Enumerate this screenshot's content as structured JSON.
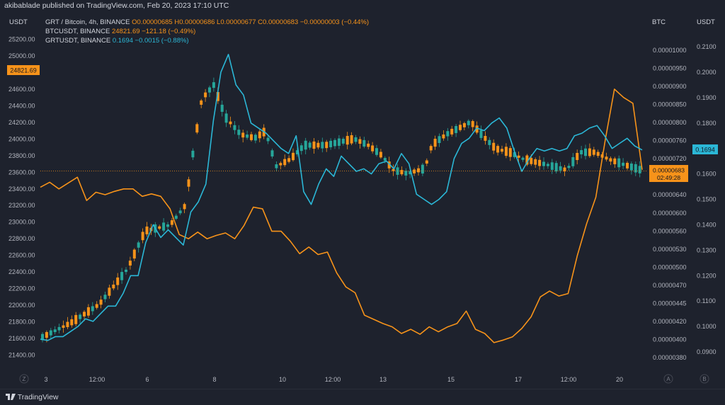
{
  "header": {
    "publisher": "akibablade published on TradingView.com, Feb 20, 2023 17:10 UTC"
  },
  "legend": {
    "grt": {
      "symbol": "GRT / Bitcoin, 4h, BINANCE",
      "ohlc": "O0.00000685 H0.00000686 L0.00000677 C0.00000683 −0.00000003 (−0.44%)"
    },
    "btc": {
      "symbol": "BTCUSDT, BINANCE",
      "value": "24821.69 −121.18 (−0.49%)"
    },
    "grtusdt": {
      "symbol": "GRTUSDT, BINANCE",
      "value": "0.1694 −0.0015 (−0.88%)"
    }
  },
  "axes": {
    "left_title": "USDT",
    "mid_title": "BTC",
    "right_title": "USDT"
  },
  "price_tags": {
    "btc": "24821.69",
    "grt_price": "0.00000683",
    "grt_countdown": "02:49:28",
    "grtusdt": "0.1694"
  },
  "footer": {
    "brand": "TradingView"
  },
  "bottom_marks": {
    "left": "Z",
    "mid": "A",
    "right": "B"
  },
  "colors": {
    "background": "#1e222d",
    "btc_line": "#f7931a",
    "grtusdt_line": "#2bb7d6",
    "candle_up": "#26a69a",
    "candle_down": "#f7931a"
  },
  "chart_data": {
    "type": "line",
    "x_tick_labels": [
      "3",
      "12:00",
      "6",
      "8",
      "10",
      "12:00",
      "13",
      "15",
      "17",
      "12:00",
      "20"
    ],
    "y_left_ticks": [
      "25200.00",
      "25000.00",
      "24600.00",
      "24400.00",
      "24200.00",
      "24000.00",
      "23800.00",
      "23600.00",
      "23400.00",
      "23200.00",
      "23000.00",
      "22800.00",
      "22600.00",
      "22400.00",
      "22200.00",
      "22000.00",
      "21800.00",
      "21600.00",
      "21400.00"
    ],
    "y_mid_ticks": [
      "0.00001000",
      "0.00000950",
      "0.00000900",
      "0.00000850",
      "0.00000800",
      "0.00000760",
      "0.00000720",
      "0.00000683",
      "0.00000640",
      "0.00000600",
      "0.00000560",
      "0.00000530",
      "0.00000500",
      "0.00000470",
      "0.00000445",
      "0.00000420",
      "0.00000400",
      "0.00000380"
    ],
    "y_right_ticks": [
      "0.2100",
      "0.2000",
      "0.1900",
      "0.1800",
      "0.1700",
      "0.1600",
      "0.1500",
      "0.1400",
      "0.1300",
      "0.1200",
      "0.1100",
      "0.1000",
      "0.0900"
    ],
    "series": [
      {
        "name": "BTCUSDT, BINANCE",
        "axis": "left",
        "values": [
          23420,
          23480,
          23400,
          23470,
          23540,
          23260,
          23360,
          23330,
          23370,
          23400,
          23400,
          23310,
          23340,
          23310,
          23160,
          22850,
          22800,
          22880,
          22800,
          22840,
          22870,
          22800,
          22960,
          23180,
          23160,
          22890,
          22890,
          22770,
          22620,
          22700,
          22610,
          22640,
          22390,
          22220,
          22150,
          21880,
          21830,
          21780,
          21740,
          21660,
          21710,
          21650,
          21740,
          21680,
          21740,
          21780,
          21930,
          21710,
          21660,
          21550,
          21580,
          21620,
          21720,
          21860,
          22100,
          22170,
          22110,
          22140,
          22600,
          22980,
          23300,
          23980,
          24600,
          24500,
          24430,
          23630
        ]
      },
      {
        "name": "GRTUSDT, BINANCE",
        "axis": "right",
        "values": [
          0.095,
          0.0945,
          0.096,
          0.096,
          0.098,
          0.1,
          0.103,
          0.102,
          0.105,
          0.108,
          0.108,
          0.113,
          0.12,
          0.12,
          0.133,
          0.14,
          0.135,
          0.138,
          0.135,
          0.132,
          0.145,
          0.149,
          0.156,
          0.181,
          0.2,
          0.207,
          0.195,
          0.191,
          0.18,
          0.178,
          0.176,
          0.173,
          0.17,
          0.168,
          0.175,
          0.153,
          0.148,
          0.156,
          0.162,
          0.159,
          0.167,
          0.164,
          0.161,
          0.162,
          0.16,
          0.164,
          0.165,
          0.162,
          0.168,
          0.164,
          0.152,
          0.15,
          0.148,
          0.15,
          0.153,
          0.166,
          0.172,
          0.174,
          0.178,
          0.177,
          0.18,
          0.182,
          0.178,
          0.169,
          0.161,
          0.166,
          0.17,
          0.169,
          0.17,
          0.169,
          0.17,
          0.175,
          0.176,
          0.178,
          0.179,
          0.175,
          0.17,
          0.172,
          0.174,
          0.171,
          0.1694
        ]
      }
    ]
  }
}
